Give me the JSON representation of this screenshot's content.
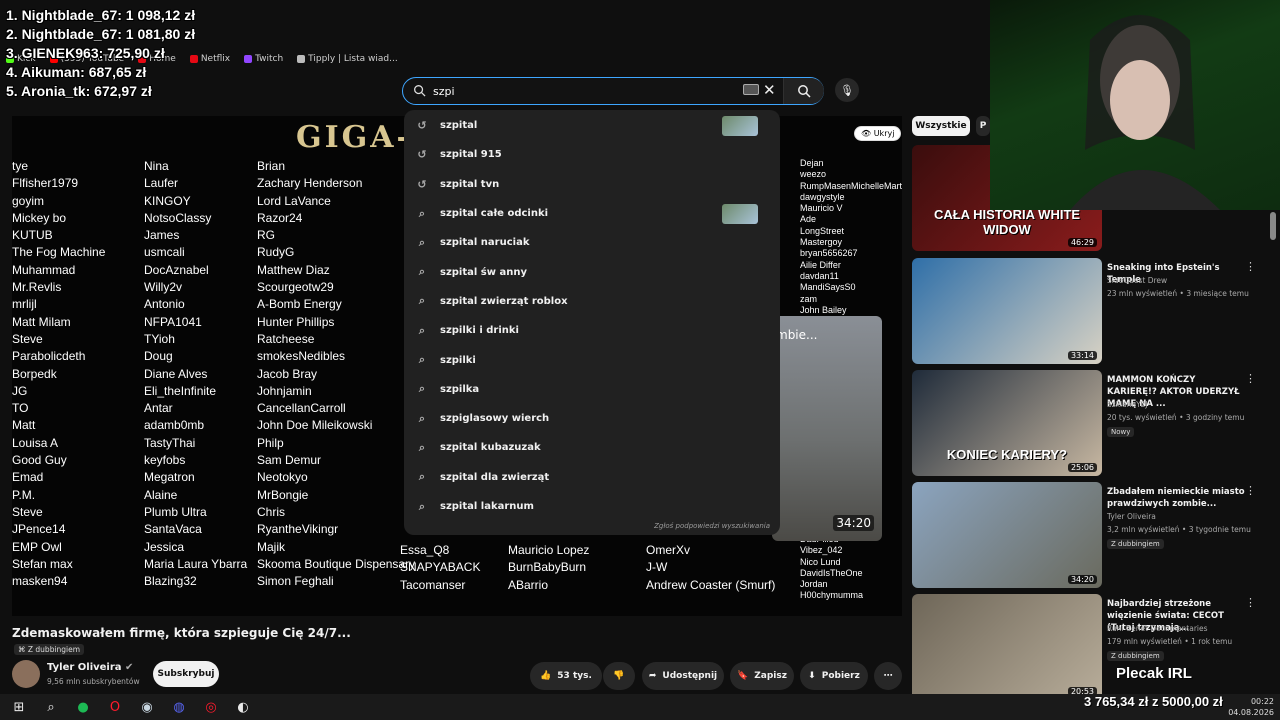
{
  "leaderboard": [
    "1. Nightblade_67: 1 098,12 zł",
    "2. Nightblade_67: 1 081,80 zł",
    "3. GIENEK963: 725,90 zł",
    "4. Aikuman: 687,65 zł",
    "5. Aronia_tk: 672,97 zł"
  ],
  "bookmarks": [
    {
      "label": "Kick",
      "color": "#53fc18"
    },
    {
      "label": "(395) YouTube",
      "color": "#ff0000"
    },
    {
      "label": "Home",
      "color": "#e50914"
    },
    {
      "label": "Netflix",
      "color": "#e50914"
    },
    {
      "label": "Twitch",
      "color": "#9146ff"
    },
    {
      "label": "Tipply | Lista wiad...",
      "color": "#bbbbbb"
    }
  ],
  "search": {
    "query": "szpi",
    "keyboard_icon": "keyboard-icon"
  },
  "suggestions": [
    {
      "text": "szpital",
      "icon": "history-icon",
      "thumb": true
    },
    {
      "text": "szpital 915",
      "icon": "history-icon",
      "thumb": false
    },
    {
      "text": "szpital tvn",
      "icon": "history-icon",
      "thumb": false
    },
    {
      "text": "szpital całe odcinki",
      "icon": "search-icon",
      "thumb": true
    },
    {
      "text": "szpital naruciak",
      "icon": "search-icon",
      "thumb": false
    },
    {
      "text": "szpital św anny",
      "icon": "search-icon",
      "thumb": false
    },
    {
      "text": "szpital zwierząt roblox",
      "icon": "search-icon",
      "thumb": false
    },
    {
      "text": "szpilki i drinki",
      "icon": "search-icon",
      "thumb": false
    },
    {
      "text": "szpilki",
      "icon": "search-icon",
      "thumb": false
    },
    {
      "text": "szpilka",
      "icon": "search-icon",
      "thumb": false
    },
    {
      "text": "szpiglasowy wierch",
      "icon": "search-icon",
      "thumb": false
    },
    {
      "text": "szpital kubazuzak",
      "icon": "search-icon",
      "thumb": false
    },
    {
      "text": "szpital dla zwierząt",
      "icon": "search-icon",
      "thumb": false
    },
    {
      "text": "szpital lakarnum",
      "icon": "search-icon",
      "thumb": false
    }
  ],
  "suggest_report": "Zgłoś podpowiedzi wyszukiwania",
  "video": {
    "banner": "GIGA-",
    "hide_label": "Ukryj",
    "columns": [
      [
        "tye",
        "Flfisher1979",
        "goyim",
        "Mickey bo",
        "KUTUB",
        "The Fog Machine",
        "Muhammad",
        "Mr.Revlis",
        "mrlijl",
        "Matt Milam",
        "Steve",
        "Parabolicdeth",
        "Borpedk",
        "JG",
        "TO",
        "Matt",
        "Louisa A",
        "Good Guy",
        "Emad",
        "P.M.",
        "Steve",
        "JPence14",
        "EMP Owl",
        "Stefan max",
        "masken94"
      ],
      [
        "Nina",
        "Laufer",
        "KINGOY",
        "NotsoClassy",
        "James",
        "usmcali",
        "DocAznabel",
        "Willy2v",
        "Antonio",
        "NFPA1041",
        "TYioh",
        "Doug",
        "Diane Alves",
        "Eli_theInfinite",
        "Antar",
        "adamb0mb",
        "TastyThai",
        "keyfobs",
        "Megatron",
        "Alaine",
        "Plumb Ultra",
        "SantaVaca",
        "Jessica",
        "Maria Laura Ybarra",
        "Blazing32"
      ],
      [
        "Brian",
        "Zachary Henderson",
        "Lord LaVance",
        "Razor24",
        "RG",
        "RudyG",
        "Matthew Diaz",
        "Scourgeotw29",
        "A-Bomb Energy",
        "Hunter Phillips",
        "Ratcheese",
        "smokesNedibles",
        "Jacob Bray",
        "Johnjamin",
        "CancellanCarroll",
        "John Doe Mileikowski",
        "Philp",
        "Sam Demur",
        "Neotokyo",
        "MrBongie",
        "Chris",
        "RyantheVikingr",
        "Majik",
        "Skooma Boutique Dispensary",
        "Simon Feghali"
      ],
      [
        "Essa_Q8",
        "SNAPYABACK",
        "Tacomanser"
      ],
      [
        "Mauricio Lopez",
        "BurnBabyBurn",
        "ABarrio"
      ],
      [
        "OmerXv",
        "J-W",
        "Andrew Coaster (Smurf)"
      ],
      [
        "Dejan",
        "weezo",
        "RumpMasenMichelleMart",
        "dawgystyle",
        "Mauricio V",
        "Ade",
        "LongStreet",
        "Mastergoy",
        "bryan5656267",
        "Ailie Differ",
        "davdan11",
        "MandiSaysS0",
        "zam",
        "John Bailey"
      ],
      [
        "DadPilled",
        "Vibez_042",
        "Nico Lund",
        "DavidIsTheOne",
        "Jordan",
        "H00chymumma"
      ]
    ],
    "inset_title": "mbie...",
    "inset_duration": "34:20",
    "title": "Zdemaskowałem firmę, która szpieguje Cię 24/7...",
    "dub_label": "Z dubbingiem",
    "channel": "Tyler Oliveira",
    "subscribers": "9,56 mln subskrybentów",
    "subscribe_label": "Subskrybuj",
    "likes": "53 tys.",
    "share_label": "Udostępnij",
    "save_label": "Zapisz",
    "download_label": "Pobierz"
  },
  "chips": [
    "Wszystkie",
    "P"
  ],
  "recommended": [
    {
      "title": "",
      "channel": "",
      "meta": "",
      "badge": "",
      "duration": "46:29",
      "overlay": "CAŁA HISTORIA WHITE WIDOW",
      "colors": [
        "#3a0d0d",
        "#8a1c1c"
      ]
    },
    {
      "title": "Sneaking into Epstein's Temple",
      "channel": "SideQuest Drew",
      "meta": "23 mln wyświetleń • 3 miesiące temu",
      "badge": "",
      "duration": "33:14",
      "overlay": "",
      "colors": [
        "#2f6fa8",
        "#d8d2c4"
      ]
    },
    {
      "title": "MAMMON KOŃCZY KARIERĘ!? AKTOR UDERZYŁ MAMĘ NA ...",
      "channel": "SzklanaY2J",
      "meta": "20 tys. wyświetleń • 3 godziny temu",
      "badge": "Nowy",
      "duration": "25:06",
      "overlay": "KONIEC KARIERY?",
      "colors": [
        "#1f2b3a",
        "#c8b8a2"
      ]
    },
    {
      "title": "Zbadałem niemieckie miasto prawdziwych zombie...",
      "channel": "Tyler Oliveira",
      "meta": "3,2 mln wyświetleń • 3 tygodnie temu",
      "badge": "Z dubbingiem",
      "duration": "34:20",
      "overlay": "",
      "colors": [
        "#8ba4bf",
        "#6a6a5e"
      ]
    },
    {
      "title": "Najbardziej strzeżone więzienie świata: CECOT (Tutaj trzymają...",
      "channel": "Ruhi Cenet Documentaries",
      "meta": "179 mln wyświetleń • 1 rok temu",
      "badge": "Z dubbingiem",
      "duration": "20:53",
      "overlay": "",
      "colors": [
        "#6e6658",
        "#b8ad9a"
      ]
    }
  ],
  "goal_top": "Plecak IRL",
  "goal_amount": "3 765,34 zł z 5000,00 zł",
  "clock": {
    "time": "00:22",
    "date": "04.08.2026"
  },
  "taskbar_icons": [
    "start-icon",
    "search-icon",
    "spotify-icon",
    "opera-icon",
    "steam-icon",
    "discord-icon",
    "opera-gx-icon",
    "chrome-icon"
  ]
}
